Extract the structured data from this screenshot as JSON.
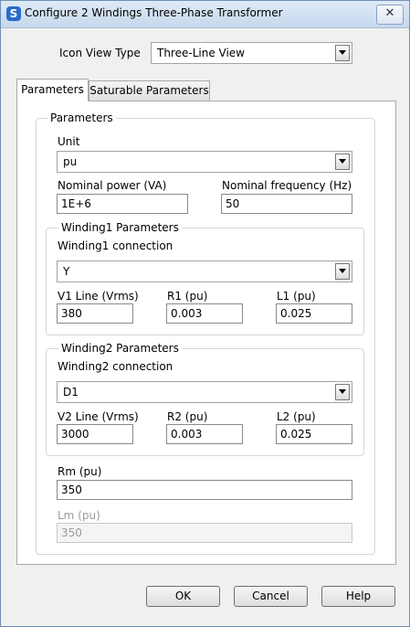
{
  "window": {
    "title": "Configure 2 Windings Three-Phase Transformer",
    "icon": "simulink-s-icon",
    "close_label": "✕"
  },
  "icon_view": {
    "label": "Icon View Type",
    "value": "Three-Line View"
  },
  "tabs": [
    {
      "label": "Parameters"
    },
    {
      "label": "Saturable Parameters"
    }
  ],
  "parameters": {
    "group_title": "Parameters",
    "unit": {
      "label": "Unit",
      "value": "pu"
    },
    "nominal_power": {
      "label": "Nominal power (VA)",
      "value": "1E+6"
    },
    "nominal_frequency": {
      "label": "Nominal frequency (Hz)",
      "value": "50"
    },
    "winding1": {
      "title": "Winding1 Parameters",
      "connection_label": "Winding1 connection",
      "connection_value": "Y",
      "v_label": "V1 Line (Vrms)",
      "v_value": "380",
      "r_label": "R1 (pu)",
      "r_value": "0.003",
      "l_label": "L1 (pu)",
      "l_value": "0.025"
    },
    "winding2": {
      "title": "Winding2 Parameters",
      "connection_label": "Winding2 connection",
      "connection_value": "D1",
      "v_label": "V2 Line (Vrms)",
      "v_value": "3000",
      "r_label": "R2 (pu)",
      "r_value": "0.003",
      "l_label": "L2 (pu)",
      "l_value": "0.025"
    },
    "rm": {
      "label": "Rm (pu)",
      "value": "350"
    },
    "lm": {
      "label": "Lm (pu)",
      "value": "350"
    }
  },
  "buttons": {
    "ok": "OK",
    "cancel": "Cancel",
    "help": "Help"
  }
}
